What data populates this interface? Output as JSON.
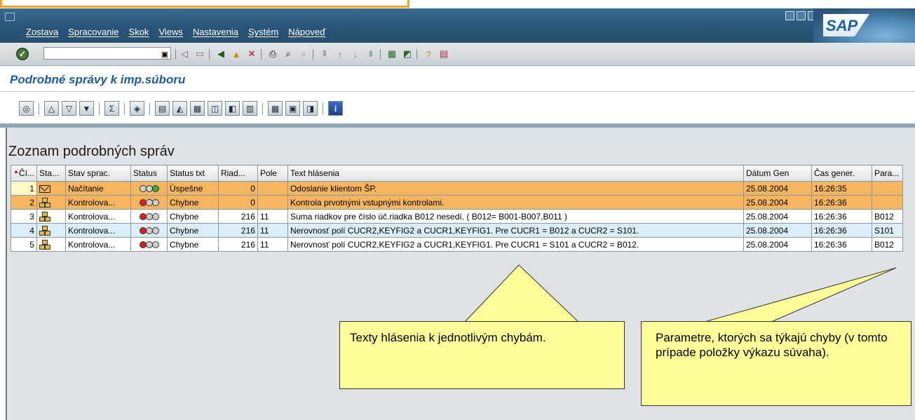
{
  "menu": [
    "Zostava",
    "Spracovanie",
    "Skok",
    "Views",
    "Nastavenia",
    "Systém",
    "Nápoveď"
  ],
  "sap_logo": "SAP",
  "screen_title": "Podrobné správy k imp.súboru",
  "list_title": "Zoznam podrobných správ",
  "columns": [
    "Čí...",
    "Sta...",
    "Stav sprac.",
    "Status",
    "Status txt",
    "Riad...",
    "Pole",
    "Text hlásenia",
    "Dátum Gen",
    "Čas gener.",
    "Para..."
  ],
  "rows": [
    {
      "n": "1",
      "icon": "envelope-icon",
      "stav": "Načítanie",
      "lights": [
        "#cfcfcf",
        "#cfcfcf",
        "#2fb52f"
      ],
      "status_txt": "Úspešne",
      "riad": "0",
      "pole": "",
      "text": "Odoslanie klientom ŠP.",
      "datum": "25.08.2004",
      "cas": "16:26:35",
      "para": "",
      "style": "orange"
    },
    {
      "n": "2",
      "icon": "hierarchy-icon",
      "stav": "Kontrolova...",
      "lights": [
        "#e11d1d",
        "#cfcfcf",
        "#cfcfcf"
      ],
      "status_txt": "Chybne",
      "riad": "0",
      "pole": "",
      "text": "Kontrola prvotnými  vstupnými kontrolami.",
      "datum": "25.08.2004",
      "cas": "16:26:36",
      "para": "",
      "style": "orange"
    },
    {
      "n": "3",
      "icon": "hierarchy-icon",
      "stav": "Kontrolova...",
      "lights": [
        "#e11d1d",
        "#cfcfcf",
        "#cfcfcf"
      ],
      "status_txt": "Chybne",
      "riad": "216",
      "pole": "11",
      "text": "Suma riadkov pre číslo úč.riadka B012 nesedí. ( B012= B001-B007,B011 )",
      "datum": "25.08.2004",
      "cas": "16:26:36",
      "para": "B012",
      "style": "white"
    },
    {
      "n": "4",
      "icon": "hierarchy-icon",
      "stav": "Kontrolova...",
      "lights": [
        "#e11d1d",
        "#cfcfcf",
        "#cfcfcf"
      ],
      "status_txt": "Chybne",
      "riad": "216",
      "pole": "11",
      "text": "Nerovnosť polí CUCR2,KEYFIG2 a CUCR1,KEYFIG1. Pre CUCR1 = B012 a CUCR2 = S101.",
      "datum": "25.08.2004",
      "cas": "16:26:36",
      "para": "S101",
      "style": "blue"
    },
    {
      "n": "5",
      "icon": "hierarchy-icon",
      "stav": "Kontrolova...",
      "lights": [
        "#e11d1d",
        "#cfcfcf",
        "#cfcfcf"
      ],
      "status_txt": "Chybne",
      "riad": "216",
      "pole": "11",
      "text": "Nerovnosť polí CUCR2,KEYFIG2 a CUCR1,KEYFIG1. Pre CUCR1 = S101 a CUCR2 = B012.",
      "datum": "25.08.2004",
      "cas": "16:26:36",
      "para": "B012",
      "style": "white"
    }
  ],
  "callouts": {
    "texts": "Texty hlásenia k jednotlivým chybám.",
    "params": "Parametre, ktorých sa týkajú chyby (v tomto prípade položky výkazu súvaha)."
  },
  "colors": {
    "title_bar": "#2a5577",
    "row_orange": "#f6b55e",
    "row_blue": "#dbeef8",
    "callout": "#ffff99",
    "frame_orange": "#f4a21d"
  }
}
